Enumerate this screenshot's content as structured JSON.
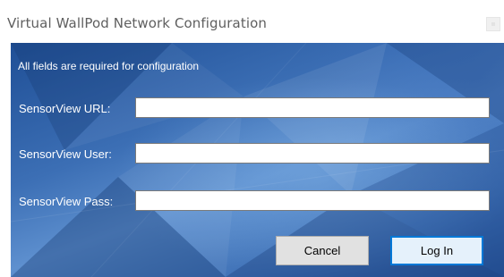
{
  "window": {
    "title": "Virtual WallPod Network Configuration"
  },
  "form": {
    "info_text": "All fields are required for configuration",
    "url": {
      "label": "SensorView URL:",
      "value": "",
      "placeholder": ""
    },
    "user": {
      "label": "SensorView User:",
      "value": "",
      "placeholder": ""
    },
    "pass": {
      "label": "SensorView Pass:",
      "value": "",
      "placeholder": ""
    }
  },
  "buttons": {
    "cancel_label": "Cancel",
    "login_label": "Log In"
  },
  "colors": {
    "background_blue": "#3c6fb5",
    "accent_focus": "#0078d7",
    "label_text": "#ffffff"
  },
  "icons": {
    "close": "close-icon"
  }
}
